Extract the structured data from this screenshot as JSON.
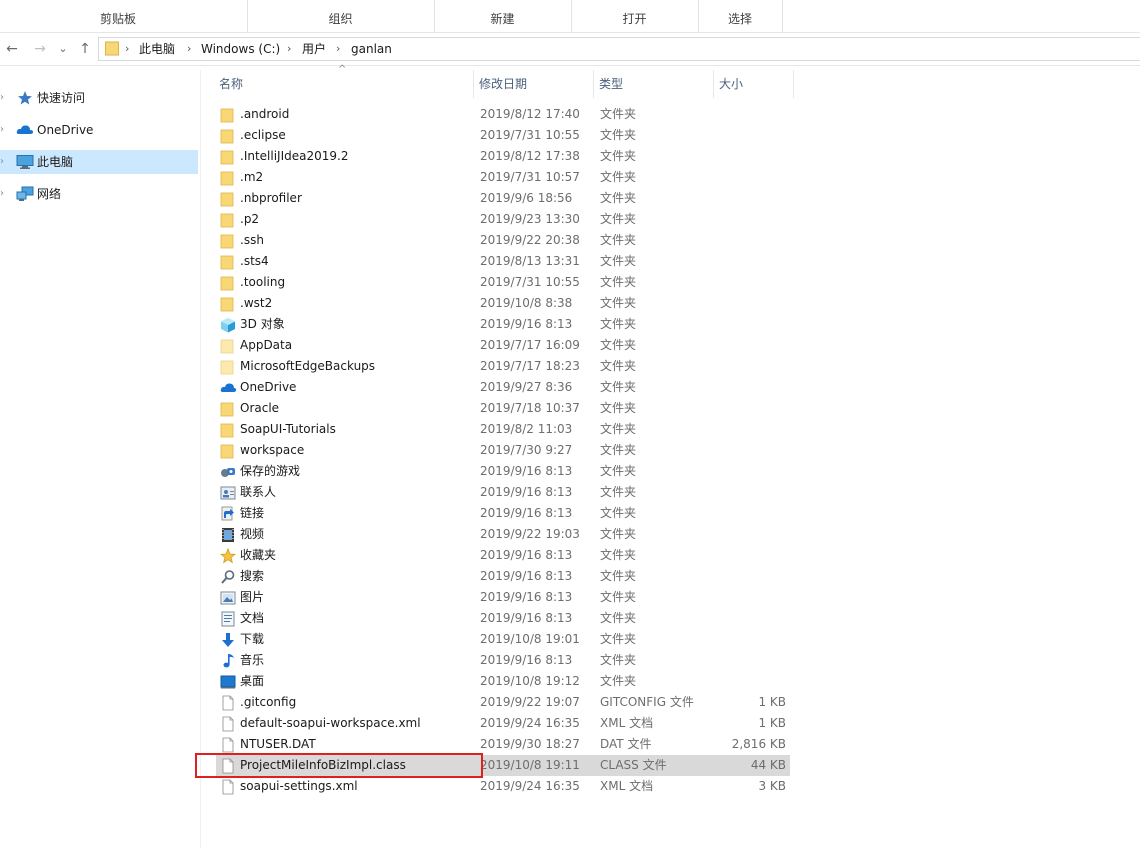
{
  "ribbon": {
    "groups": [
      "剪贴板",
      "组织",
      "新建",
      "打开",
      "选择"
    ]
  },
  "address": {
    "crumbs": [
      "此电脑",
      "Windows (C:)",
      "用户",
      "ganlan"
    ],
    "sep": "›"
  },
  "nav_buttons": {
    "back": "←",
    "forward": "→",
    "recent": "⌄",
    "up": "↑"
  },
  "sidebar": {
    "items": [
      {
        "label": "快速访问",
        "icon": "star-icon"
      },
      {
        "label": "OneDrive",
        "icon": "cloud-icon"
      },
      {
        "label": "此电脑",
        "icon": "monitor-icon"
      },
      {
        "label": "网络",
        "icon": "network-icon"
      }
    ],
    "expander": "›"
  },
  "columns": {
    "name": "名称",
    "date": "修改日期",
    "type": "类型",
    "size": "大小",
    "sort_indicator": "^"
  },
  "files": [
    {
      "name": ".android",
      "date": "2019/8/12 17:40",
      "type": "文件夹",
      "size": "",
      "icon": "folder"
    },
    {
      "name": ".eclipse",
      "date": "2019/7/31 10:55",
      "type": "文件夹",
      "size": "",
      "icon": "folder"
    },
    {
      "name": ".IntelliJIdea2019.2",
      "date": "2019/8/12 17:38",
      "type": "文件夹",
      "size": "",
      "icon": "folder"
    },
    {
      "name": ".m2",
      "date": "2019/7/31 10:57",
      "type": "文件夹",
      "size": "",
      "icon": "folder"
    },
    {
      "name": ".nbprofiler",
      "date": "2019/9/6 18:56",
      "type": "文件夹",
      "size": "",
      "icon": "folder"
    },
    {
      "name": ".p2",
      "date": "2019/9/23 13:30",
      "type": "文件夹",
      "size": "",
      "icon": "folder"
    },
    {
      "name": ".ssh",
      "date": "2019/9/22 20:38",
      "type": "文件夹",
      "size": "",
      "icon": "folder"
    },
    {
      "name": ".sts4",
      "date": "2019/8/13 13:31",
      "type": "文件夹",
      "size": "",
      "icon": "folder"
    },
    {
      "name": ".tooling",
      "date": "2019/7/31 10:55",
      "type": "文件夹",
      "size": "",
      "icon": "folder"
    },
    {
      "name": ".wst2",
      "date": "2019/10/8 8:38",
      "type": "文件夹",
      "size": "",
      "icon": "folder"
    },
    {
      "name": "3D 对象",
      "date": "2019/9/16 8:13",
      "type": "文件夹",
      "size": "",
      "icon": "cube"
    },
    {
      "name": "AppData",
      "date": "2019/7/17 16:09",
      "type": "文件夹",
      "size": "",
      "icon": "folder-light"
    },
    {
      "name": "MicrosoftEdgeBackups",
      "date": "2019/7/17 18:23",
      "type": "文件夹",
      "size": "",
      "icon": "folder-light"
    },
    {
      "name": "OneDrive",
      "date": "2019/9/27 8:36",
      "type": "文件夹",
      "size": "",
      "icon": "cloud"
    },
    {
      "name": "Oracle",
      "date": "2019/7/18 10:37",
      "type": "文件夹",
      "size": "",
      "icon": "folder"
    },
    {
      "name": "SoapUI-Tutorials",
      "date": "2019/8/2 11:03",
      "type": "文件夹",
      "size": "",
      "icon": "folder"
    },
    {
      "name": "workspace",
      "date": "2019/7/30 9:27",
      "type": "文件夹",
      "size": "",
      "icon": "folder"
    },
    {
      "name": "保存的游戏",
      "date": "2019/9/16 8:13",
      "type": "文件夹",
      "size": "",
      "icon": "games"
    },
    {
      "name": "联系人",
      "date": "2019/9/16 8:13",
      "type": "文件夹",
      "size": "",
      "icon": "contacts"
    },
    {
      "name": "链接",
      "date": "2019/9/16 8:13",
      "type": "文件夹",
      "size": "",
      "icon": "link"
    },
    {
      "name": "视频",
      "date": "2019/9/22 19:03",
      "type": "文件夹",
      "size": "",
      "icon": "video"
    },
    {
      "name": "收藏夹",
      "date": "2019/9/16 8:13",
      "type": "文件夹",
      "size": "",
      "icon": "star"
    },
    {
      "name": "搜索",
      "date": "2019/9/16 8:13",
      "type": "文件夹",
      "size": "",
      "icon": "search"
    },
    {
      "name": "图片",
      "date": "2019/9/16 8:13",
      "type": "文件夹",
      "size": "",
      "icon": "picture"
    },
    {
      "name": "文档",
      "date": "2019/9/16 8:13",
      "type": "文件夹",
      "size": "",
      "icon": "document"
    },
    {
      "name": "下载",
      "date": "2019/10/8 19:01",
      "type": "文件夹",
      "size": "",
      "icon": "download"
    },
    {
      "name": "音乐",
      "date": "2019/9/16 8:13",
      "type": "文件夹",
      "size": "",
      "icon": "music"
    },
    {
      "name": "桌面",
      "date": "2019/10/8 19:12",
      "type": "文件夹",
      "size": "",
      "icon": "desktop"
    },
    {
      "name": ".gitconfig",
      "date": "2019/9/22 19:07",
      "type": "GITCONFIG 文件",
      "size": "1 KB",
      "icon": "file"
    },
    {
      "name": "default-soapui-workspace.xml",
      "date": "2019/9/24 16:35",
      "type": "XML 文档",
      "size": "1 KB",
      "icon": "file"
    },
    {
      "name": "NTUSER.DAT",
      "date": "2019/9/30 18:27",
      "type": "DAT 文件",
      "size": "2,816 KB",
      "icon": "file"
    },
    {
      "name": "ProjectMileInfoBizImpl.class",
      "date": "2019/10/8 19:11",
      "type": "CLASS 文件",
      "size": "44 KB",
      "icon": "file",
      "selected": true
    },
    {
      "name": "soapui-settings.xml",
      "date": "2019/9/24 16:35",
      "type": "XML 文档",
      "size": "3 KB",
      "icon": "file"
    }
  ],
  "colors": {
    "folder": "#f8d775",
    "folder_dark": "#e8b84a",
    "selection": "#d9d9d9",
    "nav_selection": "#cce8ff",
    "annotation": "#e02020"
  }
}
